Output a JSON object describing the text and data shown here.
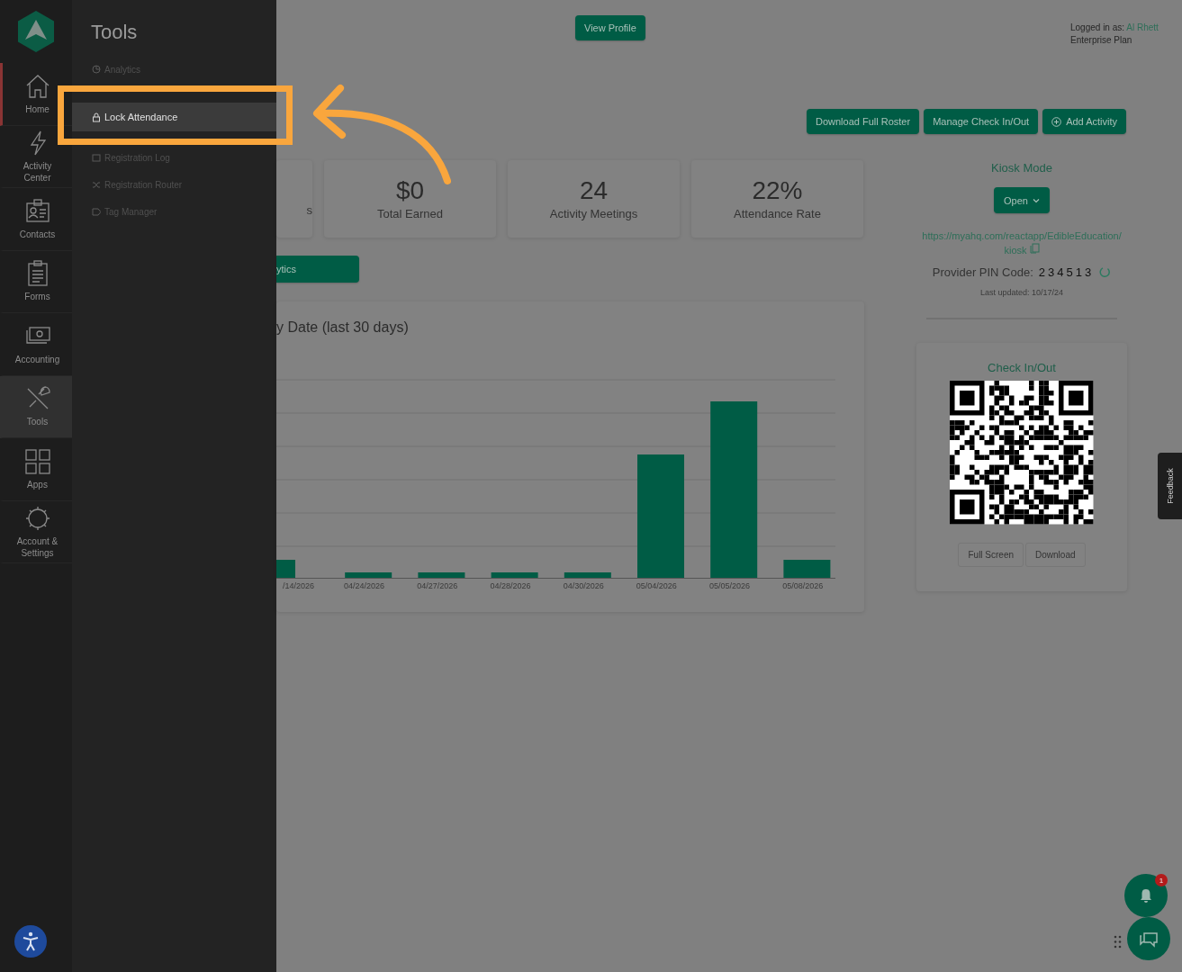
{
  "sidebar": {
    "items": [
      {
        "label": "Home",
        "selected": true,
        "expanded": false
      },
      {
        "label": "Activity Center",
        "selected": false,
        "expanded": false
      },
      {
        "label": "Contacts",
        "selected": false,
        "expanded": false
      },
      {
        "label": "Forms",
        "selected": false,
        "expanded": false
      },
      {
        "label": "Accounting",
        "selected": false,
        "expanded": false
      },
      {
        "label": "Tools",
        "selected": false,
        "expanded": true
      },
      {
        "label": "Apps",
        "selected": false,
        "expanded": false
      },
      {
        "label": "Account & Settings",
        "selected": false,
        "expanded": false
      }
    ]
  },
  "flyout": {
    "title": "Tools",
    "items": [
      {
        "label": "Analytics",
        "selected": false
      },
      {
        "label": "Lock Attendance",
        "selected": true
      },
      {
        "label": "Registration Log",
        "selected": false
      },
      {
        "label": "Registration Router",
        "selected": false
      },
      {
        "label": "Tag Manager",
        "selected": false
      }
    ]
  },
  "header": {
    "view_profile": "View Profile",
    "logged_in_label": "Logged in as:",
    "user": "Al Rhett",
    "plan": "Enterprise Plan"
  },
  "actions": [
    "Download Full Roster",
    "Manage Check In/Out",
    "Add Activity"
  ],
  "stats": [
    {
      "label": "s"
    },
    {
      "value": "$0",
      "label": "Total Earned"
    },
    {
      "value": "24",
      "label": "Activity Meetings"
    },
    {
      "value": "22%",
      "label": "Attendance Rate"
    }
  ],
  "analytics_button": "ytics",
  "chart": {
    "title": "y Date (last 30 days)",
    "x_labels": [
      "/14/2026",
      "04/24/2026",
      "04/27/2026",
      "04/28/2026",
      "04/30/2026",
      "05/04/2026",
      "05/05/2026",
      "05/08/2026"
    ]
  },
  "kiosk": {
    "title": "Kiosk Mode",
    "open_button": "Open",
    "url": "https://myahq.com/reactapp/EdibleEducation/kiosk",
    "pin_label": "Provider PIN Code:",
    "pin": "234513",
    "last_updated": "Last updated: 10/17/24"
  },
  "check_in": {
    "title": "Check In/Out",
    "buttons": [
      "Full Screen",
      "Download"
    ]
  },
  "feedback": "Feedback",
  "notification_count": "1"
}
